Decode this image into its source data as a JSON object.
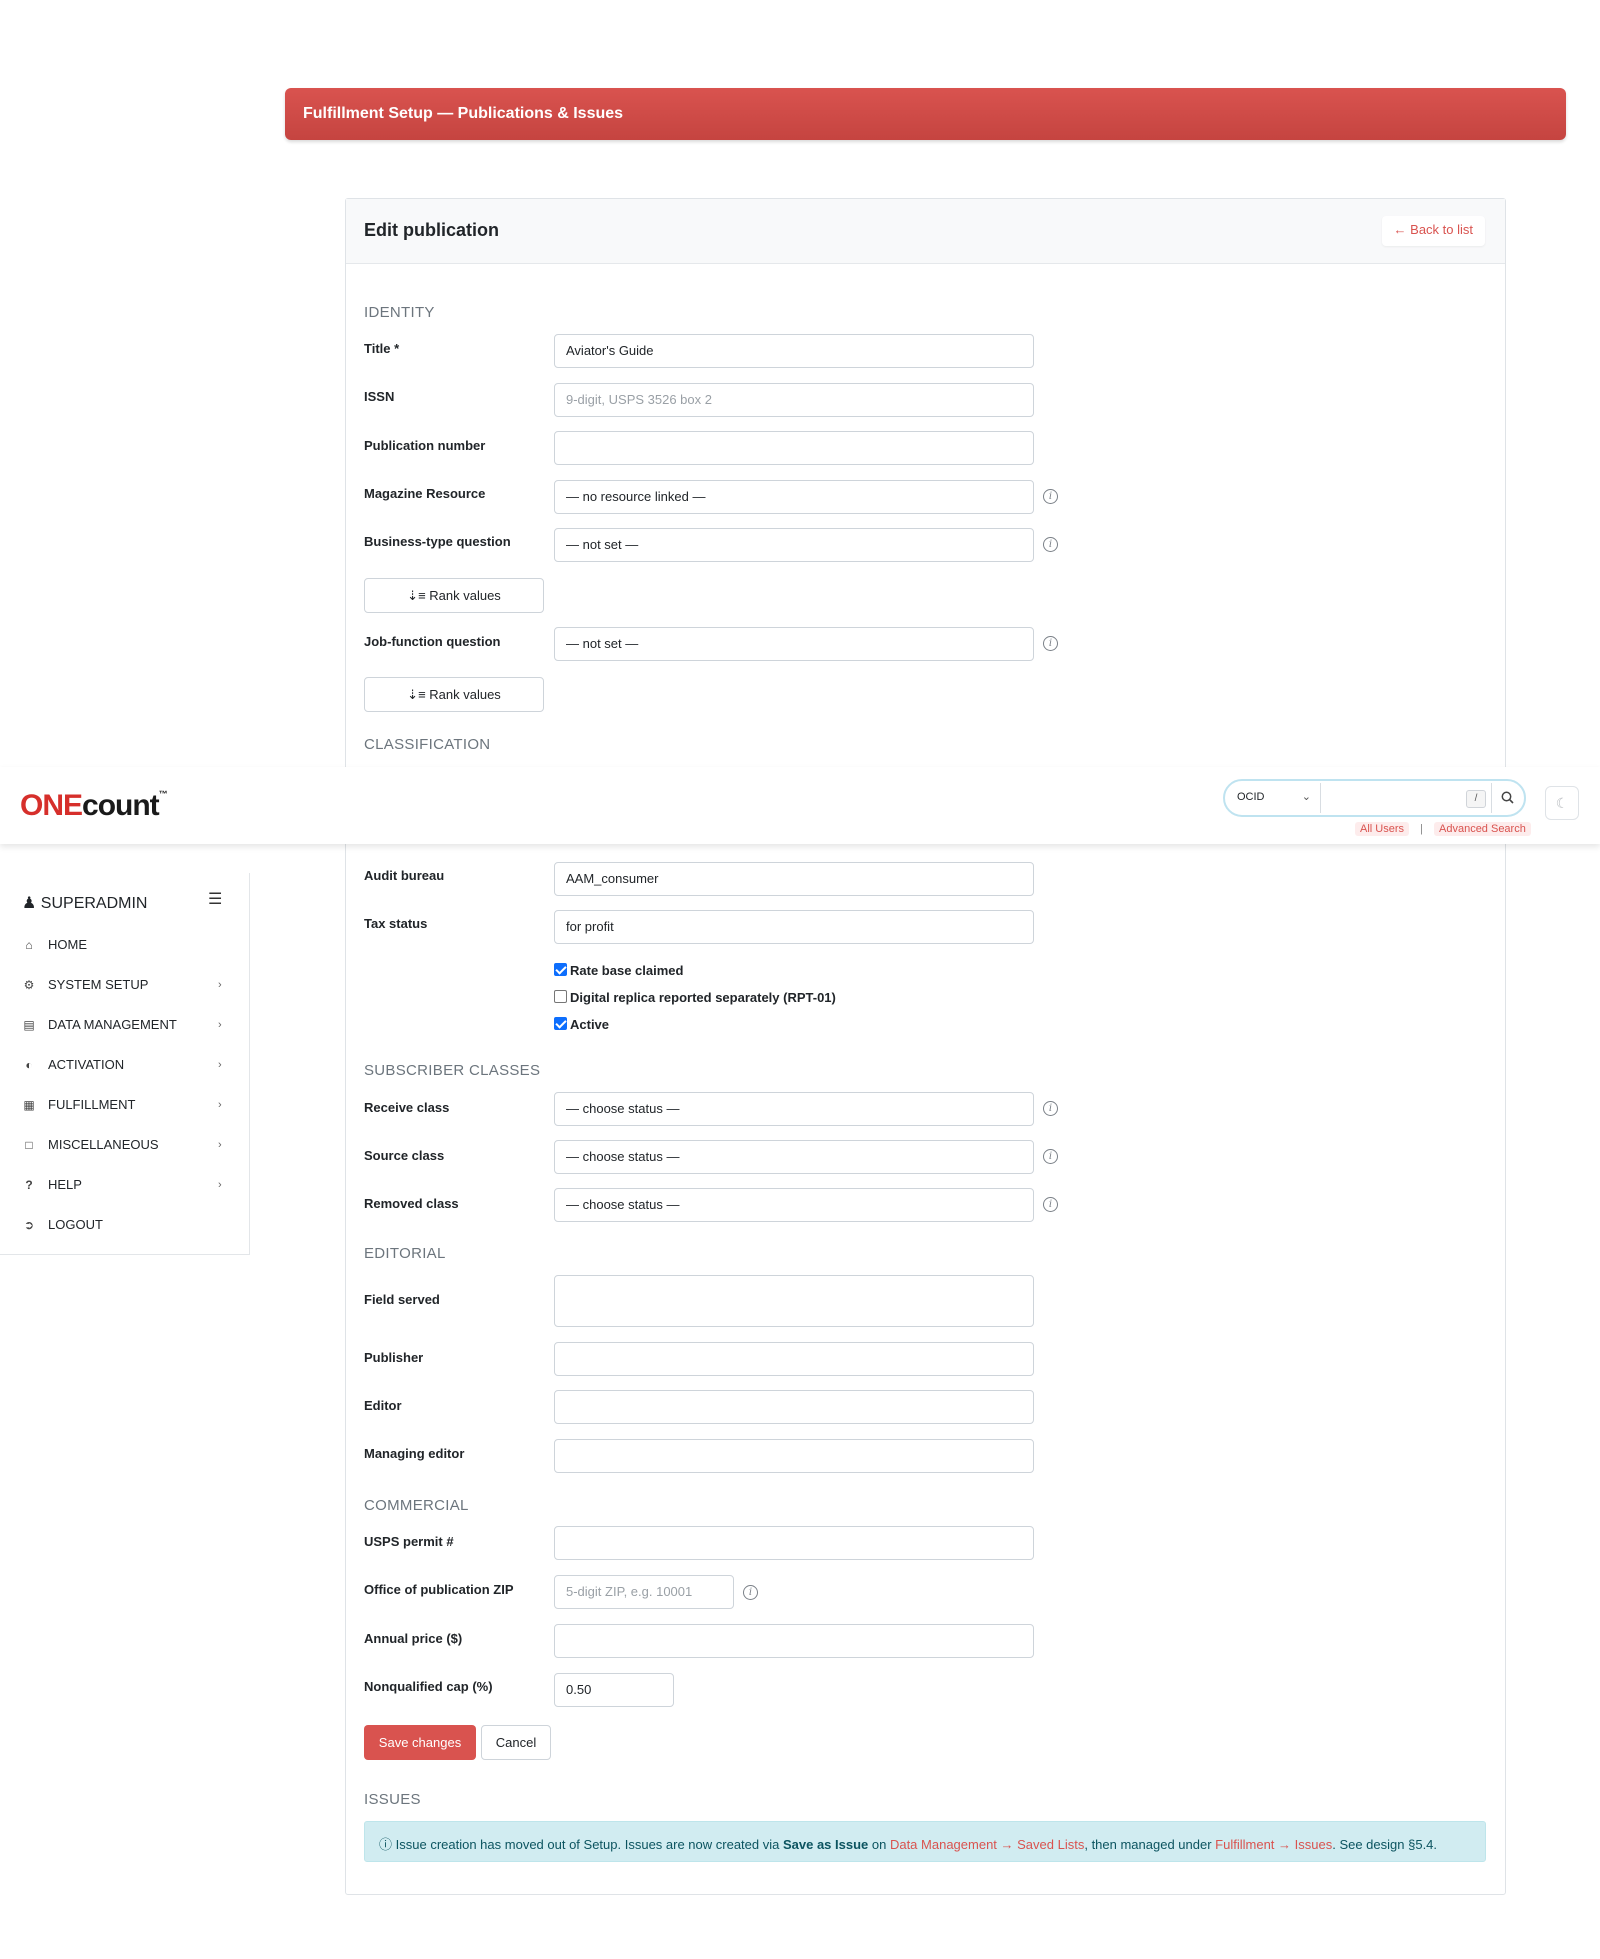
{
  "banner": {
    "title": "Fulfillment Setup — Publications & Issues"
  },
  "card": {
    "title": "Edit publication",
    "back_label": "← Back to list"
  },
  "sections": {
    "identity": "IDENTITY",
    "classification": "CLASSIFICATION",
    "subscriber_classes": "SUBSCRIBER CLASSES",
    "editorial": "EDITORIAL",
    "commercial": "COMMERCIAL",
    "issues": "ISSUES"
  },
  "identity": {
    "title_label": "Title *",
    "title_value": "Aviator's Guide",
    "issn_label": "ISSN",
    "issn_placeholder": "9-digit, USPS 3526 box 2",
    "pubnum_label": "Publication number",
    "pubnum_value": "",
    "resource_label": "Magazine Resource",
    "resource_value": "— no resource linked —",
    "business_label": "Business-type question",
    "business_value": "— not set —",
    "rank_values_label": "Rank values",
    "job_label": "Job-function question",
    "job_value": "— not set —"
  },
  "classification": {
    "audit_label": "Audit bureau",
    "audit_value": "AAM_consumer",
    "tax_label": "Tax status",
    "tax_value": "for profit",
    "checkboxes": [
      {
        "label": "Rate base claimed",
        "checked": true
      },
      {
        "label": "Digital replica reported separately (RPT-01)",
        "checked": false
      },
      {
        "label": "Active",
        "checked": true
      }
    ]
  },
  "subscriber": {
    "receive_label": "Receive class",
    "source_label": "Source class",
    "removed_label": "Removed class",
    "choose_status": "— choose status —"
  },
  "editorial": {
    "field_label": "Field served",
    "publisher_label": "Publisher",
    "editor_label": "Editor",
    "managing_label": "Managing editor"
  },
  "commercial": {
    "permit_label": "USPS permit #",
    "zip_label": "Office of publication ZIP",
    "zip_placeholder": "5-digit ZIP, e.g. 10001",
    "price_label": "Annual price ($)",
    "cap_label": "Nonqualified cap (%)",
    "cap_value": "0.50"
  },
  "actions": {
    "save": "Save changes",
    "cancel": "Cancel"
  },
  "alert": {
    "text1": "Issue creation has moved out of Setup. Issues are now created via ",
    "bold": "Save as Issue",
    "text2": " on ",
    "link1": "Data Management → Saved Lists",
    "text3": ", then managed under ",
    "link2": "Fulfillment → Issues",
    "text4": ". See design §5.4."
  },
  "navbar": {
    "logo_one": "ONE",
    "logo_count": "count",
    "logo_tm": "™",
    "search_type": "OCID",
    "slash_hint": "/",
    "all_users": "All Users",
    "separator": "|",
    "advanced_search": "Advanced Search"
  },
  "sidebar": {
    "user": "SUPERADMIN",
    "items": [
      {
        "label": "HOME",
        "icon": "home-icon"
      },
      {
        "label": "SYSTEM SETUP",
        "icon": "gear-icon"
      },
      {
        "label": "DATA MANAGEMENT",
        "icon": "database-icon"
      },
      {
        "label": "ACTIVATION",
        "icon": "toggle-icon"
      },
      {
        "label": "FULFILLMENT",
        "icon": "newspaper-icon"
      },
      {
        "label": "MISCELLANEOUS",
        "icon": "file-icon"
      },
      {
        "label": "HELP",
        "icon": "question-icon"
      },
      {
        "label": "LOGOUT",
        "icon": "logout-icon"
      }
    ]
  },
  "colors": {
    "brand_red": "#d9534f",
    "info_bg": "#d1ecf1",
    "check_blue": "#0d6efd"
  }
}
